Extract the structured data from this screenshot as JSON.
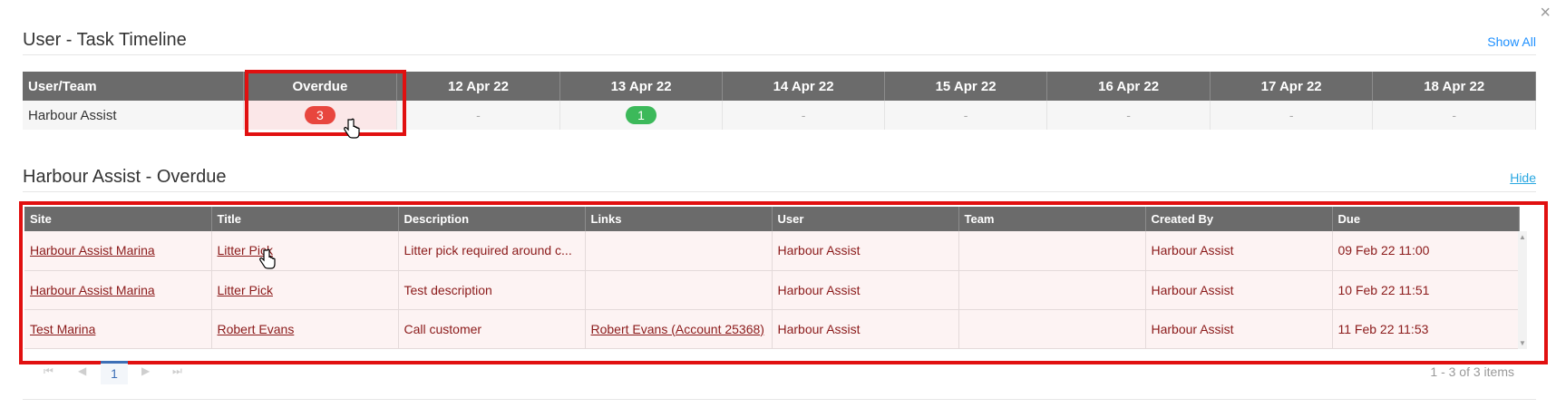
{
  "timeline": {
    "title": "User - Task Timeline",
    "show_all_label": "Show All",
    "headers": [
      "User/Team",
      "Overdue",
      "12 Apr 22",
      "13 Apr 22",
      "14 Apr 22",
      "15 Apr 22",
      "16 Apr 22",
      "17 Apr 22",
      "18 Apr 22"
    ],
    "row": {
      "user": "Harbour Assist",
      "overdue_count": "3",
      "cells": [
        "-",
        "1",
        "-",
        "-",
        "-",
        "-",
        "-"
      ]
    }
  },
  "overdue": {
    "title": "Harbour Assist - Overdue",
    "hide_label": "Hide",
    "columns": [
      "Site",
      "Title",
      "Description",
      "Links",
      "User",
      "Team",
      "Created By",
      "Due"
    ],
    "rows": [
      {
        "site": "Harbour Assist Marina",
        "title": "Litter Pick",
        "description": "Litter pick required around c...",
        "links": "",
        "user": "Harbour Assist",
        "team": "",
        "created_by": "Harbour Assist",
        "due": "09 Feb 22 11:00"
      },
      {
        "site": "Harbour Assist Marina",
        "title": "Litter Pick",
        "description": "Test description",
        "links": "",
        "user": "Harbour Assist",
        "team": "",
        "created_by": "Harbour Assist",
        "due": "10 Feb 22 11:51"
      },
      {
        "site": "Test Marina",
        "title": "Robert Evans",
        "description": "Call customer",
        "links": "Robert Evans (Account 25368)",
        "user": "Harbour Assist",
        "team": "",
        "created_by": "Harbour Assist",
        "due": "11 Feb 22 11:53"
      }
    ],
    "pager": {
      "current_page": "1",
      "info": "1 - 3 of 3 items"
    }
  },
  "icons": {
    "close": "close-icon",
    "cursor": "hand-pointer-icon",
    "first": "first-page-icon",
    "prev": "prev-page-icon",
    "next": "next-page-icon",
    "last": "last-page-icon"
  },
  "colors": {
    "header_bg": "#6b6b6b",
    "overdue_pill": "#e8463e",
    "due_pill": "#3cb95a",
    "highlight": "#e11010",
    "overdue_text": "#8b1a1a",
    "link": "#29a7e1"
  }
}
